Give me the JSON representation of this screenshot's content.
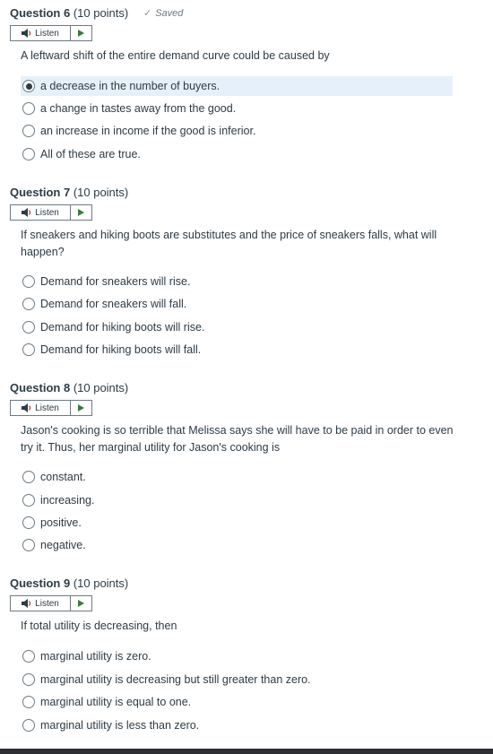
{
  "listen_label": "Listen",
  "saved_label": "Saved",
  "questions": [
    {
      "title": "Question 6",
      "points": "(10 points)",
      "text": "A leftward shift of the entire demand curve could be caused by",
      "answers": [
        "a decrease in the number of buyers.",
        "a change in tastes away from the good.",
        "an increase in income if the good is inferior.",
        "All of these are true."
      ],
      "selected_index": 0
    },
    {
      "title": "Question 7",
      "points": "(10 points)",
      "text": "If sneakers and hiking boots are substitutes and the price of sneakers falls, what will happen?",
      "answers": [
        "Demand for sneakers will rise.",
        "Demand for sneakers will fall.",
        "Demand for hiking boots will rise.",
        "Demand for hiking boots will fall."
      ]
    },
    {
      "title": "Question 8",
      "points": "(10 points)",
      "text": "Jason's cooking is so terrible that Melissa says she will have to be paid in order to even try it. Thus, her marginal utility for Jason's cooking is",
      "answers": [
        "constant.",
        "increasing.",
        "positive.",
        "negative."
      ]
    },
    {
      "title": "Question 9",
      "points": "(10 points)",
      "text": "If total utility is decreasing, then",
      "answers": [
        "marginal utility is zero.",
        "marginal utility is decreasing but still greater than zero.",
        "marginal utility is equal to one.",
        "marginal utility is less than zero."
      ]
    }
  ]
}
